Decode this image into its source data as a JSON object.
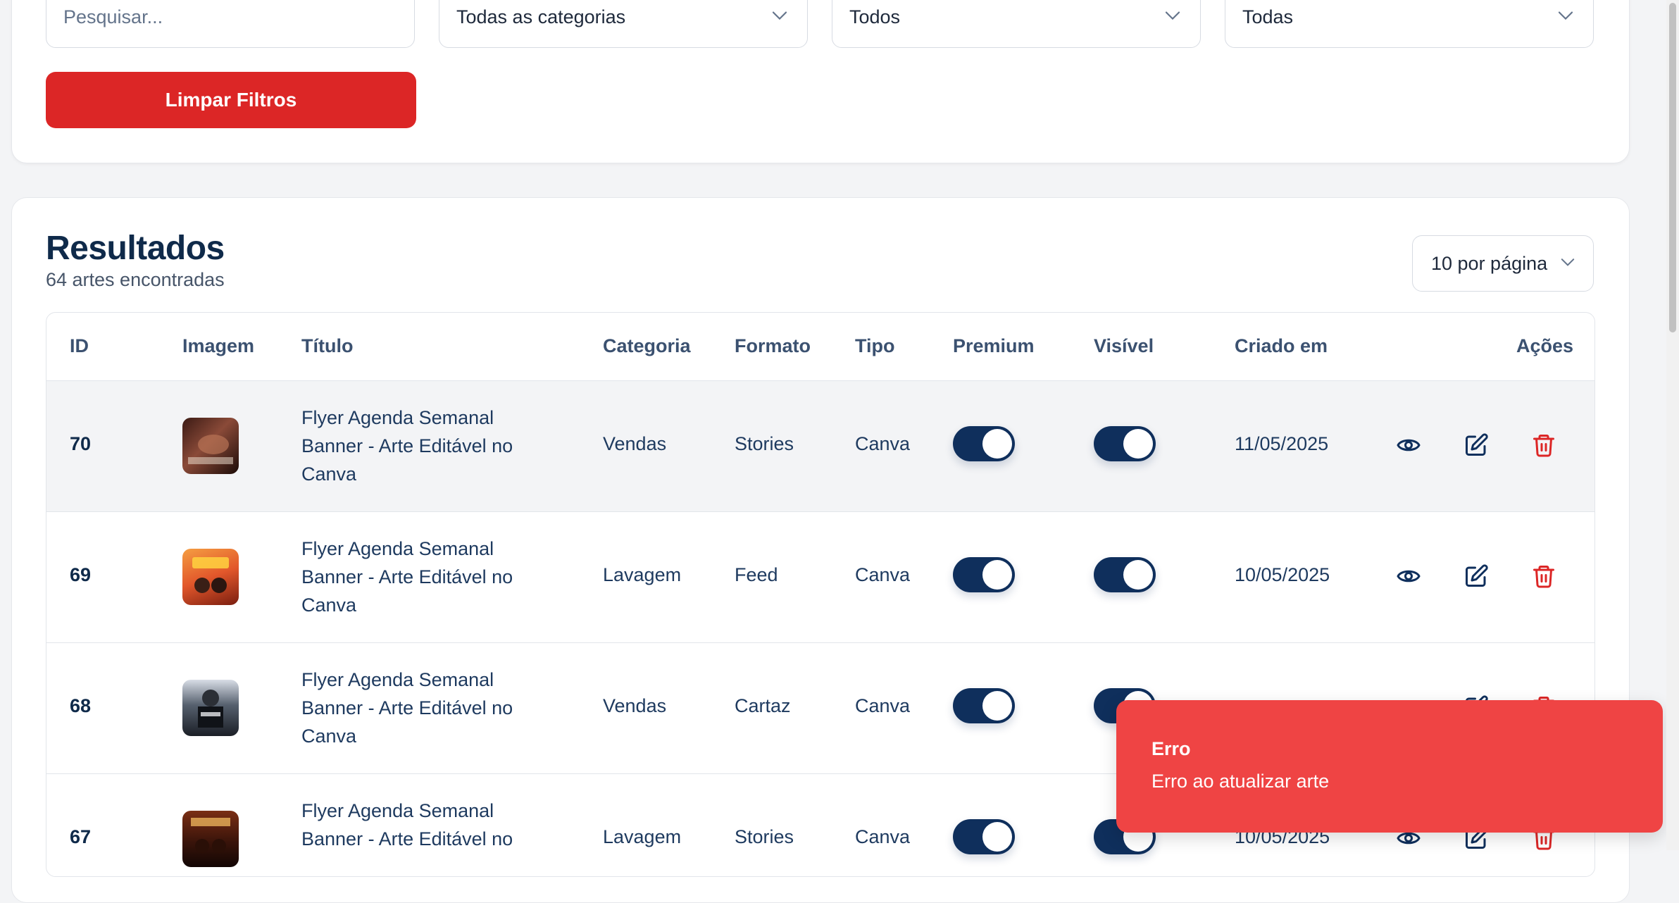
{
  "filters": {
    "search_placeholder": "Pesquisar...",
    "category_value": "Todas as categorias",
    "type_value": "Todos",
    "format_value": "Todas",
    "clear_label": "Limpar Filtros"
  },
  "results": {
    "title": "Resultados",
    "count": "64 artes encontradas",
    "per_page": "10 por página"
  },
  "table": {
    "headers": {
      "id": "ID",
      "image": "Imagem",
      "title": "Título",
      "category": "Categoria",
      "format": "Formato",
      "type": "Tipo",
      "premium": "Premium",
      "visible": "Visível",
      "created": "Criado em",
      "actions": "Ações"
    },
    "rows": [
      {
        "id": "70",
        "title": "Flyer Agenda Semanal Banner - Arte Editável no Canva",
        "category": "Vendas",
        "format": "Stories",
        "type": "Canva",
        "premium": true,
        "visible": true,
        "created": "11/05/2025"
      },
      {
        "id": "69",
        "title": "Flyer Agenda Semanal Banner - Arte Editável no Canva",
        "category": "Lavagem",
        "format": "Feed",
        "type": "Canva",
        "premium": true,
        "visible": true,
        "created": "10/05/2025"
      },
      {
        "id": "68",
        "title": "Flyer Agenda Semanal Banner - Arte Editável no Canva",
        "category": "Vendas",
        "format": "Cartaz",
        "type": "Canva",
        "premium": true,
        "visible": true,
        "created": ""
      },
      {
        "id": "67",
        "title": "Flyer Agenda Semanal Banner - Arte Editável no",
        "category": "Lavagem",
        "format": "Stories",
        "type": "Canva",
        "premium": true,
        "visible": true,
        "created": "10/05/2025"
      }
    ]
  },
  "toast": {
    "title": "Erro",
    "message": "Erro ao atualizar arte"
  },
  "colors": {
    "primary": "#0f2f5c",
    "danger": "#dc2626",
    "toast": "#ef4444"
  }
}
